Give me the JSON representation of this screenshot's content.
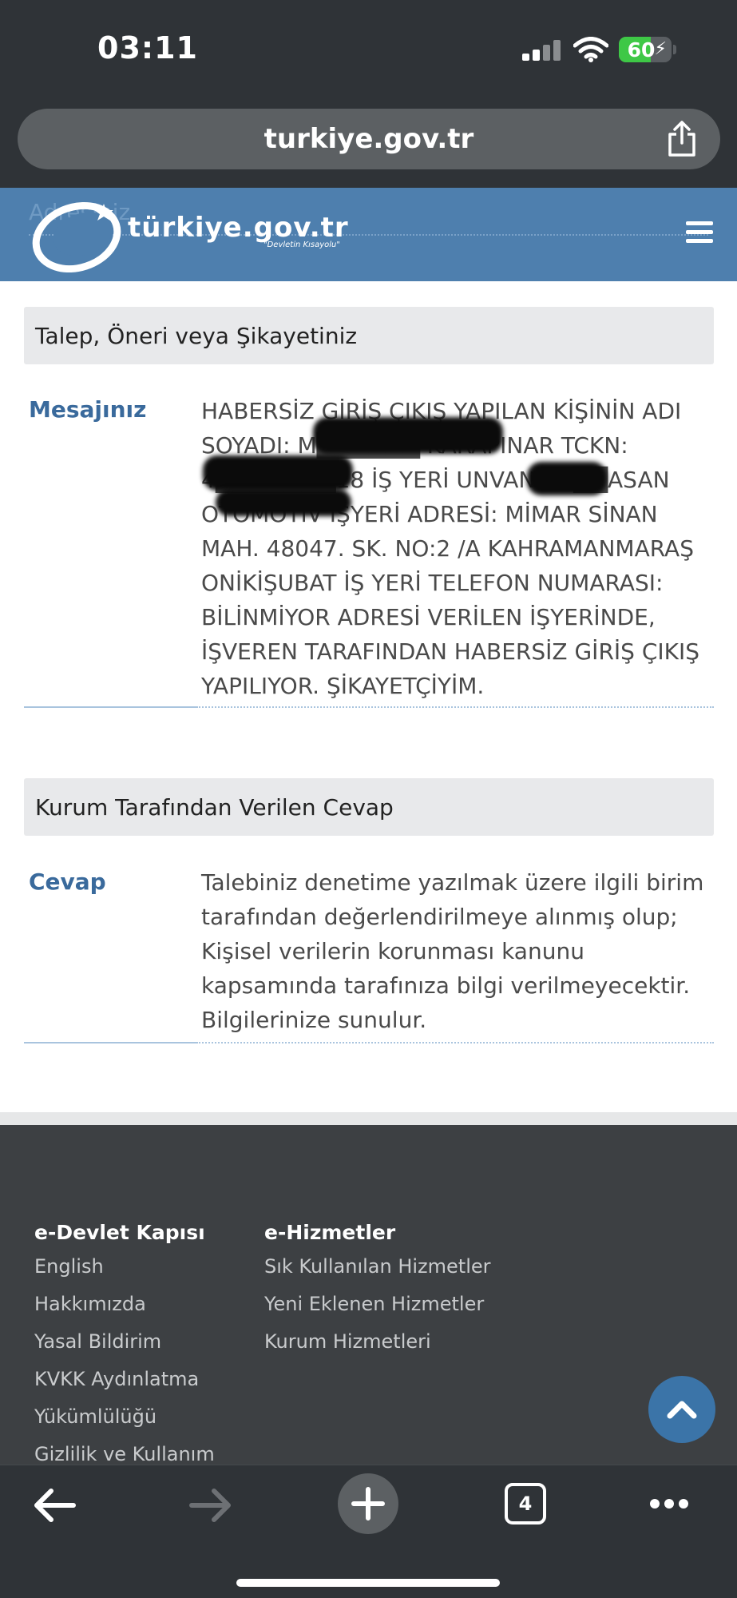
{
  "status_bar": {
    "time": "03:11",
    "battery": "60"
  },
  "browser": {
    "url": "turkiye.gov.tr",
    "tab_count": "4"
  },
  "header": {
    "ghost_label": "Adresiniz",
    "logo_text": "türkiye.gov.tr",
    "logo_slogan": "\"Devletin Kısayolu\""
  },
  "request_section": {
    "title": "Talep, Öneri veya Şikayetiniz",
    "message_label": "Mesajınız",
    "message_text": "HABERSİZ GİRİŞ ÇIKIŞ YAPILAN KİŞİNİN ADI SOYADI: M██████ KARAPINAR TCKN: 4███████18 İŞ YERİ UNVANI: H██ASAN OTOMOTİV İŞYERİ ADRESİ: MİMAR SİNAN MAH. 48047. SK. NO:2 /A KAHRAMANMARAŞ ONİKİŞUBAT İŞ YERİ TELEFON NUMARASI: BİLİNMİYOR ADRESİ VERİLEN İŞYERİNDE, İŞVEREN TARAFINDAN HABERSİZ GİRİŞ ÇIKIŞ YAPILIYOR. ŞİKAYETÇİYİM."
  },
  "response_section": {
    "title": "Kurum Tarafından Verilen Cevap",
    "answer_label": "Cevap",
    "answer_text": "Talebiniz denetime yazılmak üzere ilgili birim tarafından değerlendirilmeye alınmış olup; Kişisel verilerin korunması kanunu kapsamında tarafınıza bilgi verilmeyecektir. Bilgilerinize sunulur."
  },
  "footer": {
    "col1": {
      "title": "e-Devlet Kapısı",
      "links": [
        "English",
        "Hakkımızda",
        "Yasal Bildirim",
        "KVKK Aydınlatma",
        "Yükümlülüğü",
        "Gizlilik ve Kullanım"
      ]
    },
    "col2": {
      "title": "e-Hizmetler",
      "links": [
        "Sık Kullanılan Hizmetler",
        "Yeni Eklenen Hizmetler",
        "Kurum Hizmetleri"
      ]
    }
  },
  "colors": {
    "header_blue": "#4e7fae",
    "label_blue": "#3a6a9c",
    "footer_bg": "#3d4043",
    "browser_chrome": "#2f3337"
  },
  "icons": [
    "signal-icon",
    "wifi-icon",
    "battery-icon",
    "share-icon",
    "menu-icon",
    "chevron-up-icon",
    "back-arrow-icon",
    "forward-arrow-icon",
    "plus-icon",
    "tabs-icon",
    "more-icon"
  ]
}
